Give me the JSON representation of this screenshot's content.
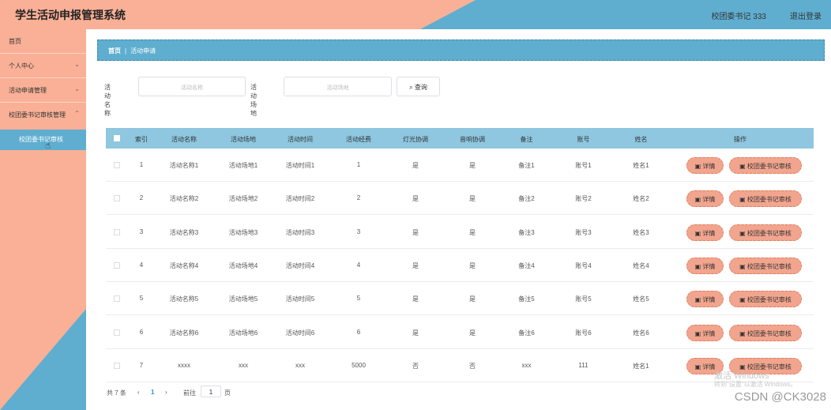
{
  "header": {
    "title": "学生活动申报管理系统",
    "user": "校团委书记 333",
    "logout": "退出登录"
  },
  "sidebar": {
    "items": [
      "首页",
      "个人中心",
      "活动申请管理",
      "校团委书记审核管理"
    ],
    "sub_item": "校团委书记审核"
  },
  "breadcrumb": {
    "home": "首页",
    "separator": "|",
    "current": "活动申请"
  },
  "search": {
    "name_label": "活动名称",
    "name_placeholder": "活动名称",
    "place_label": "活动场地",
    "place_placeholder": "活动场地",
    "button": "查询"
  },
  "table": {
    "headers": [
      "索引",
      "活动名称",
      "活动场地",
      "活动时间",
      "活动经费",
      "灯光协调",
      "音响协调",
      "备注",
      "账号",
      "姓名",
      "操作"
    ],
    "rows": [
      [
        "1",
        "活动名称1",
        "活动场地1",
        "活动时间1",
        "1",
        "是",
        "是",
        "备注1",
        "账号1",
        "姓名1"
      ],
      [
        "2",
        "活动名称2",
        "活动场地2",
        "活动时间2",
        "2",
        "是",
        "是",
        "备注2",
        "账号2",
        "姓名2"
      ],
      [
        "3",
        "活动名称3",
        "活动场地3",
        "活动时间3",
        "3",
        "是",
        "是",
        "备注3",
        "账号3",
        "姓名3"
      ],
      [
        "4",
        "活动名称4",
        "活动场地4",
        "活动时间4",
        "4",
        "是",
        "是",
        "备注4",
        "账号4",
        "姓名4"
      ],
      [
        "5",
        "活动名称5",
        "活动场地5",
        "活动时间5",
        "5",
        "是",
        "是",
        "备注5",
        "账号5",
        "姓名5"
      ],
      [
        "6",
        "活动名称6",
        "活动场地6",
        "活动时间6",
        "6",
        "是",
        "是",
        "备注6",
        "账号6",
        "姓名6"
      ],
      [
        "7",
        "xxxx",
        "xxx",
        "xxx",
        "5000",
        "否",
        "否",
        "xxx",
        "111",
        "姓名1"
      ]
    ],
    "detail_button": "详情",
    "audit_button": "校团委书记审核"
  },
  "pager": {
    "total": "共 7 条",
    "prev": "‹",
    "current_page": "1",
    "next": "›",
    "goto_label": "前往",
    "goto_value": "1",
    "goto_unit": "页"
  },
  "watermark": {
    "line1": "激活 Windows",
    "line2": "转到\"设置\"以激活 Windows。",
    "csdn": "CSDN @CK3028"
  },
  "colors": {
    "salmon": "#f9b096",
    "blue": "#5faed0",
    "table_header": "#8ec7df",
    "button": "#f2a58e"
  }
}
